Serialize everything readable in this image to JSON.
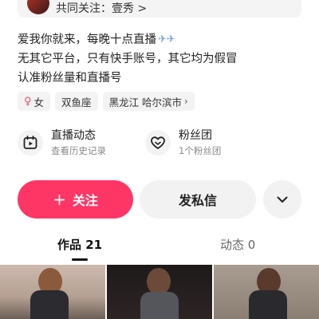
{
  "header": {
    "mutual_follow_text": "共同关注：壹秀 >"
  },
  "bio": {
    "lines": [
      "爱我你就来，每晚十点直播",
      "无其它平台，只有快手账号，其它均为假冒",
      "认准粉丝量和直播号"
    ],
    "emoji": "✈✈"
  },
  "tags": [
    {
      "icon": "female-icon",
      "glyph": "♀",
      "label": "女"
    },
    {
      "label": "双鱼座"
    },
    {
      "label": "黑龙江 哈尔滨市",
      "chevron": "›"
    }
  ],
  "features": {
    "live": {
      "title": "直播动态",
      "subtitle": "查看历史记录",
      "icon": "live-calendar-icon"
    },
    "fans": {
      "title": "粉丝团",
      "subtitle": "1个粉丝团",
      "icon": "heart-badge-icon"
    }
  },
  "actions": {
    "follow_plus": "+",
    "follow_label": "关注",
    "message_label": "发私信",
    "more_icon": "chevron-down-icon"
  },
  "tabs": [
    {
      "label": "作品 21",
      "active": true
    },
    {
      "label": "动态 0",
      "active": false
    }
  ],
  "colors": {
    "accent": "#fe3666",
    "chip_bg": "#f3f3f4",
    "female": "#f0486b"
  }
}
